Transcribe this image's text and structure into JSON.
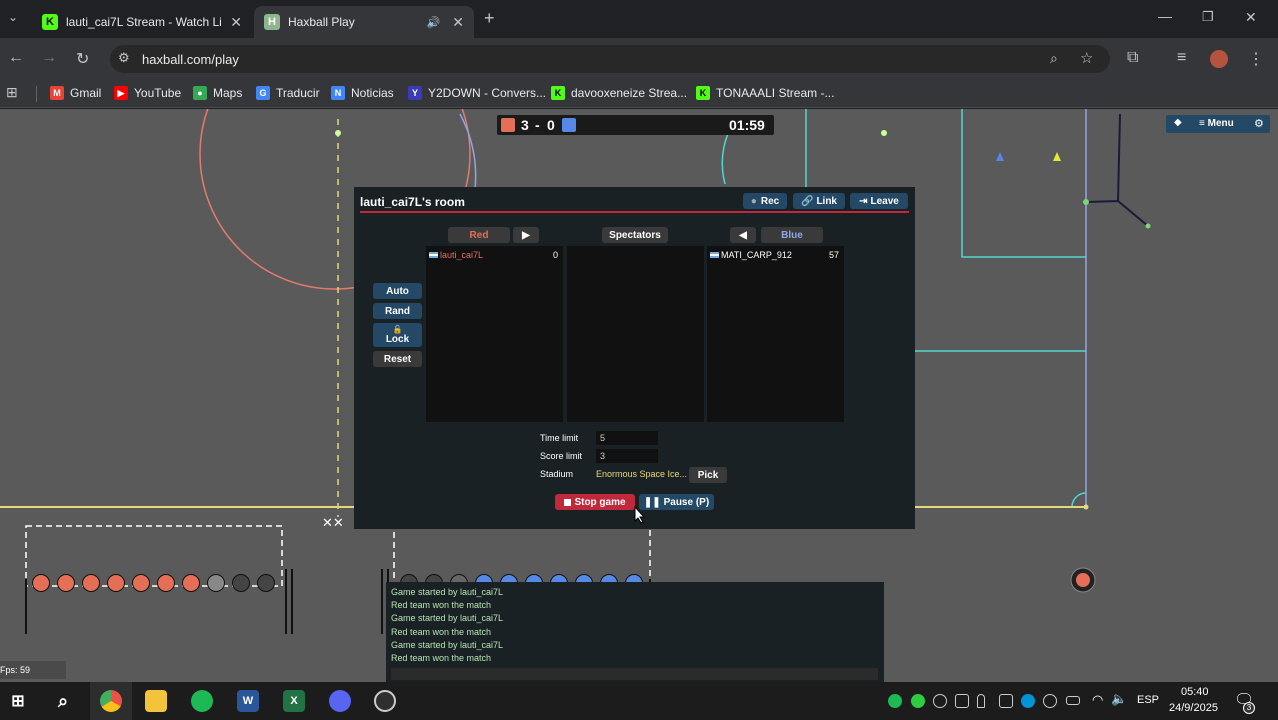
{
  "browser": {
    "tabs": [
      {
        "title": "lauti_cai7L Stream - Watch Live",
        "favicon": "K"
      },
      {
        "title": "Haxball Play",
        "favicon": "H"
      }
    ],
    "new_tab": "+",
    "url": "haxball.com/play",
    "bookmarks": [
      {
        "label": "Gmail",
        "color": "#ea4335"
      },
      {
        "label": "YouTube",
        "color": "#ff0000"
      },
      {
        "label": "Maps",
        "color": "#34a853"
      },
      {
        "label": "Traducir",
        "color": "#4285f4"
      },
      {
        "label": "Noticias",
        "color": "#4285f4"
      },
      {
        "label": "Y2DOWN - Convers...",
        "color": "#3b3bb8"
      },
      {
        "label": "davooxeneize Strea...",
        "color": "#53fc18"
      },
      {
        "label": "TONAAALI Stream -...",
        "color": "#53fc18"
      }
    ]
  },
  "scoreboard": {
    "red_score": "3",
    "separator": "-",
    "blue_score": "0",
    "time": "01:59"
  },
  "top_right_menu": {
    "menu_label": "Menu"
  },
  "room": {
    "title": "lauti_cai7L's room",
    "buttons": {
      "rec": "Rec",
      "link": "Link",
      "leave": "Leave"
    },
    "red_label": "Red",
    "spectators_label": "Spectators",
    "blue_label": "Blue",
    "arrow_right": "▶",
    "arrow_left": "◀",
    "side_buttons": {
      "auto": "Auto",
      "rand": "Rand",
      "lock": "Lock",
      "reset": "Reset"
    },
    "red_players": [
      {
        "name": "lauti_cai7L",
        "score": "0"
      }
    ],
    "blue_players": [
      {
        "name": "MATI_CARP_912",
        "score": "57"
      }
    ],
    "settings": {
      "time_limit_label": "Time limit",
      "time_limit": "5",
      "score_limit_label": "Score limit",
      "score_limit": "3",
      "stadium_label": "Stadium",
      "stadium": "Enormous Space Ice...",
      "pick_label": "Pick"
    },
    "stop_label": "Stop game",
    "pause_label": "Pause (P)"
  },
  "chat": [
    "Game started by lauti_cai7L",
    "Red team won the match",
    "Game started by lauti_cai7L",
    "Red team won the match",
    "Game started by lauti_cai7L",
    "Red team won the match"
  ],
  "fps": "Fps: 59",
  "taskbar": {
    "lang": "ESP",
    "time": "05:40",
    "date": "24/9/2025",
    "notifications": "3"
  },
  "colors": {
    "red": "#e56e56",
    "blue": "#5689e5",
    "accent_red": "#c0283b",
    "button": "#244967"
  }
}
